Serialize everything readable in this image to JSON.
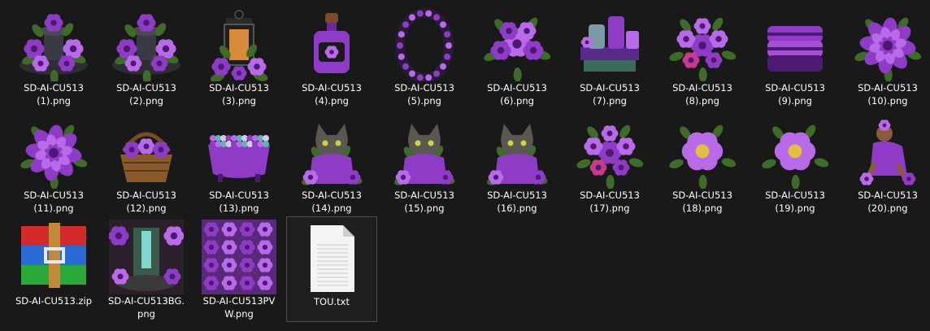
{
  "files": [
    {
      "name": "SD-AI-CU513 (1).png",
      "line1": "SD-AI-CU513",
      "line2": "(1).png",
      "icon": "fountain-thumbnail"
    },
    {
      "name": "SD-AI-CU513 (2).png",
      "line1": "SD-AI-CU513",
      "line2": "(2).png",
      "icon": "fountain-thumbnail"
    },
    {
      "name": "SD-AI-CU513 (3).png",
      "line1": "SD-AI-CU513",
      "line2": "(3).png",
      "icon": "lantern-thumbnail"
    },
    {
      "name": "SD-AI-CU513 (4).png",
      "line1": "SD-AI-CU513",
      "line2": "(4).png",
      "icon": "bottle-thumbnail"
    },
    {
      "name": "SD-AI-CU513 (5).png",
      "line1": "SD-AI-CU513",
      "line2": "(5).png",
      "icon": "frame-thumbnail"
    },
    {
      "name": "SD-AI-CU513 (6).png",
      "line1": "SD-AI-CU513",
      "line2": "(6).png",
      "icon": "flower-cluster-thumbnail"
    },
    {
      "name": "SD-AI-CU513 (7).png",
      "line1": "SD-AI-CU513",
      "line2": "(7).png",
      "icon": "spa-jars-thumbnail"
    },
    {
      "name": "SD-AI-CU513 (8).png",
      "line1": "SD-AI-CU513",
      "line2": "(8).png",
      "icon": "bouquet-thumbnail"
    },
    {
      "name": "SD-AI-CU513 (9).png",
      "line1": "SD-AI-CU513",
      "line2": "(9).png",
      "icon": "towels-thumbnail"
    },
    {
      "name": "SD-AI-CU513 (10).png",
      "line1": "SD-AI-CU513",
      "line2": "(10).png",
      "icon": "succulent-thumbnail"
    },
    {
      "name": "SD-AI-CU513 (11).png",
      "line1": "SD-AI-CU513",
      "line2": "(11).png",
      "icon": "succulent-thumbnail"
    },
    {
      "name": "SD-AI-CU513 (12).png",
      "line1": "SD-AI-CU513",
      "line2": "(12).png",
      "icon": "basket-thumbnail"
    },
    {
      "name": "SD-AI-CU513 (13).png",
      "line1": "SD-AI-CU513",
      "line2": "(13).png",
      "icon": "bathtub-thumbnail"
    },
    {
      "name": "SD-AI-CU513 (14).png",
      "line1": "SD-AI-CU513",
      "line2": "(14).png",
      "icon": "cat-thumbnail"
    },
    {
      "name": "SD-AI-CU513 (15).png",
      "line1": "SD-AI-CU513",
      "line2": "(15).png",
      "icon": "cat-thumbnail"
    },
    {
      "name": "SD-AI-CU513 (16).png",
      "line1": "SD-AI-CU513",
      "line2": "(16).png",
      "icon": "cat-thumbnail"
    },
    {
      "name": "SD-AI-CU513 (17).png",
      "line1": "SD-AI-CU513",
      "line2": "(17).png",
      "icon": "bouquet-thumbnail"
    },
    {
      "name": "SD-AI-CU513 (18).png",
      "line1": "SD-AI-CU513",
      "line2": "(18).png",
      "icon": "flower-thumbnail"
    },
    {
      "name": "SD-AI-CU513 (19).png",
      "line1": "SD-AI-CU513",
      "line2": "(19).png",
      "icon": "flower-thumbnail"
    },
    {
      "name": "SD-AI-CU513 (20).png",
      "line1": "SD-AI-CU513",
      "line2": "(20).png",
      "icon": "woman-thumbnail"
    },
    {
      "name": "SD-AI-CU513.zip",
      "line1": "SD-AI-CU513.zip",
      "line2": "",
      "icon": "winrar-archive-icon"
    },
    {
      "name": "SD-AI-CU513BG.png",
      "line1": "SD-AI-CU513BG.",
      "line2": "png",
      "icon": "background-thumbnail"
    },
    {
      "name": "SD-AI-CU513PVW.png",
      "line1": "SD-AI-CU513PV",
      "line2": "W.png",
      "icon": "preview-thumbnail"
    },
    {
      "name": "TOU.txt",
      "line1": "TOU.txt",
      "line2": "",
      "icon": "text-document-icon"
    }
  ],
  "colors": {
    "background": "#191919",
    "purple": "#8e3bc6",
    "purple_light": "#b86ae8",
    "purple_dark": "#4d1a73",
    "leaf": "#3f6b2a",
    "selection_border": "#4d4d4d"
  }
}
